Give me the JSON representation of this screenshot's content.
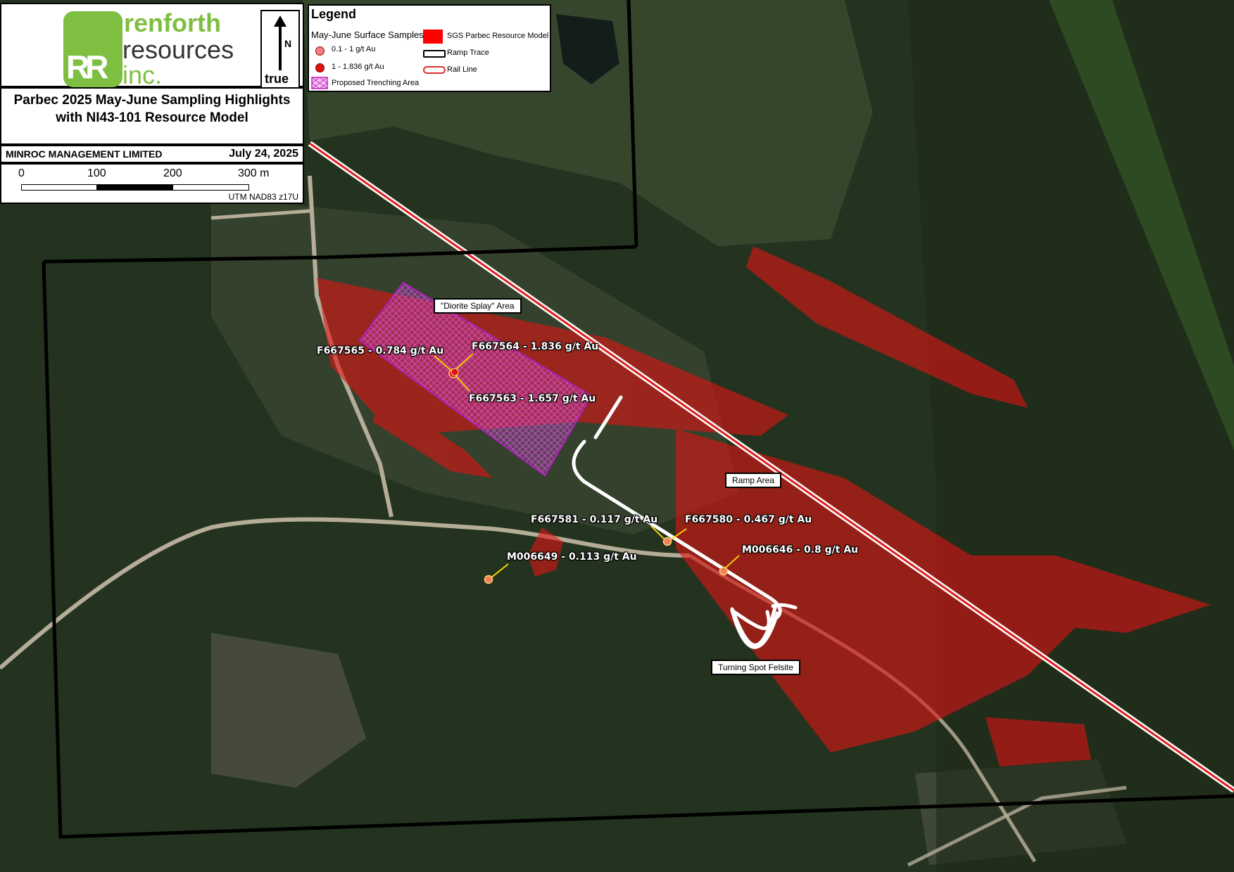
{
  "company": {
    "logo_line1": "renforth",
    "logo_line2": "resources",
    "logo_line3": "inc.",
    "logo_mark": "RR"
  },
  "north_arrow": {
    "label_n": "N",
    "label_true": "true"
  },
  "title": "Parbec 2025 May-June Sampling Highlights with NI43-101 Resource Model",
  "author": "MINROC MANAGEMENT LIMITED",
  "date": "July 24, 2025",
  "scale_bar": {
    "labels": [
      "0",
      "100",
      "200",
      "300 m"
    ],
    "projection": "UTM NAD83 z17U"
  },
  "legend": {
    "title": "Legend",
    "samples_heading": "May-June Surface Samples",
    "items": [
      {
        "label": "0.1 - 1 g/t Au",
        "color": "#f08080"
      },
      {
        "label": "1 - 1.836 g/t Au",
        "color": "#e01010"
      },
      {
        "label": "Proposed Trenching Area",
        "color": "#d040d0"
      },
      {
        "label": "SGS Parbec Resource Model",
        "color": "#ff0000"
      },
      {
        "label": "Ramp Trace",
        "color": "#ffffff"
      },
      {
        "label": "Rail Line",
        "color": "#e83a3a"
      }
    ]
  },
  "callouts": {
    "diorite": "\"Diorite Splay\" Area",
    "ramp": "Ramp Area",
    "turning": "Turning Spot Felsite"
  },
  "samples": [
    {
      "label": "F667565 - 0.784 g/t Au",
      "grade_g_t": 0.784
    },
    {
      "label": "F667564 - 1.836 g/t Au",
      "grade_g_t": 1.836
    },
    {
      "label": "F667563 - 1.657 g/t Au",
      "grade_g_t": 1.657
    },
    {
      "label": "F667581 - 0.117 g/t Au",
      "grade_g_t": 0.117
    },
    {
      "label": "F667580 - 0.467 g/t Au",
      "grade_g_t": 0.467
    },
    {
      "label": "M006646 - 0.8 g/t Au",
      "grade_g_t": 0.8
    },
    {
      "label": "M006649 - 0.113 g/t Au",
      "grade_g_t": 0.113
    }
  ]
}
